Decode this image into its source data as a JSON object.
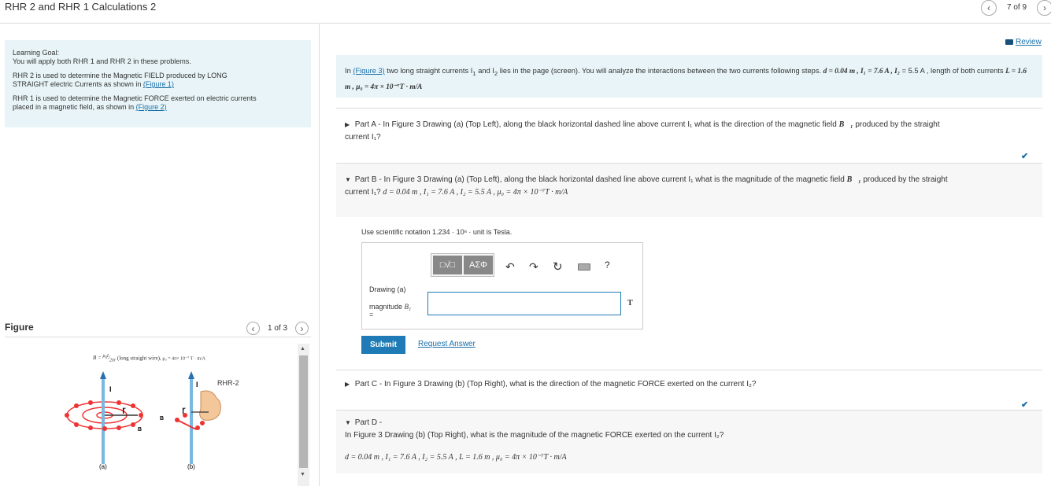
{
  "header": {
    "title": "RHR 2 and RHR 1  Calculations 2",
    "page_counter": "7 of 9",
    "review_label": "Review"
  },
  "goal": {
    "heading": "Learning Goal:",
    "line1": "You will apply both RHR 1 and RHR 2 in these problems.",
    "line2a": "RHR 2 is used to determine the Magnetic FIELD produced by LONG",
    "line2b": "STRAIGHT electric Currents as shown in",
    "line2link": "(Figure 1)",
    "line3a": "RHR 1 is used to determine the Magnetic FORCE exerted on electric currents",
    "line3b": "placed in a magnetic field, as shown in",
    "line3link": "(Figure 2)"
  },
  "intro": {
    "prefix": "In",
    "link": "(Figure 3)",
    "text1": "two long straight currents I",
    "text2": "and I",
    "text3": "lies in the page (screen). You will analyze the interactions between the two currents following steps.",
    "given1": "d = 0.04 m , I₁ = 7.6 A , I₂",
    "given2": "= 5.5 A , length of both currents",
    "given3": "L = 1.6 m , μ₀ = 4π × 10⁻⁷T · m/A"
  },
  "parts": {
    "a_label": "Part A",
    "a_text": " - In Figure 3 Drawing (a) (Top Left), along the black horizontal dashed line above current I₁ what is the direction of the magnetic field",
    "a_text2": "produced by the straight",
    "a_text3": "current I₁?",
    "b_label": "Part B",
    "b_text": " - In Figure 3 Drawing (a) (Top Left), along the black horizontal dashed line above current I₁ what is the magnitude of the magnetic field",
    "b_text2": "produced by the straight",
    "b_text3": "current I₁?",
    "b_given": "d = 0.04 m , I₁ = 7.6 A , I₂ = 5.5 A , μ₀ = 4π × 10⁻⁷T · m/A",
    "b_hint": "Use scientific notation 1.234 · 10ⁿ · unit is Tesla.",
    "c_label": "Part C",
    "c_text": " - In Figure 3 Drawing (b) (Top Right), what is the direction of the magnetic FORCE  exerted on the current I₂?",
    "d_label": "Part D",
    "d_dash": " -",
    "d_text": "In Figure 3 Drawing (b) (Top Right), what is the magnitude of the magnetic FORCE  exerted on the current I₂?",
    "d_given": "d = 0.04 m , I₁ = 7.6 A , I₂ = 5.5 A , L = 1.6 m , μ₀ = 4π × 10⁻⁷T · m/A"
  },
  "answer": {
    "greek_btn": "ΑΣΦ",
    "help_btn": "?",
    "drawing_label": "Drawing (a)",
    "magnitude_label": "magnitude",
    "magnitude_var": "B₁",
    "equals": "=",
    "input_value": "",
    "unit": "T",
    "submit_label": "Submit",
    "request_label": "Request Answer"
  },
  "figure": {
    "label": "Figure",
    "counter": "1 of 3",
    "formula": "(long straight wire),",
    "mu": "μ₀ = 4π× 10⁻⁷ T · m/A",
    "rhr2_label": "RHR-2",
    "label_i": "I",
    "label_r": "r",
    "label_b": "B",
    "caption_a": "(a)",
    "caption_b": "(b)"
  }
}
